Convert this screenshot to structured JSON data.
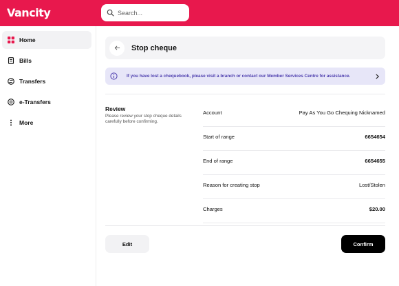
{
  "brand": {
    "logo_text": "Vancity",
    "primary_color": "#e8184d",
    "accent_purple": "#4e3fae"
  },
  "search": {
    "placeholder": "Search...",
    "icon": "search-icon"
  },
  "sidebar": {
    "items": [
      {
        "label": "Home",
        "icon": "home-grid-icon",
        "active": true
      },
      {
        "label": "Bills",
        "icon": "bill-icon",
        "active": false
      },
      {
        "label": "Transfers",
        "icon": "transfer-icon",
        "active": false
      },
      {
        "label": "e-Transfers",
        "icon": "e-transfer-icon",
        "active": false
      },
      {
        "label": "More",
        "icon": "more-vertical-icon",
        "active": false
      }
    ]
  },
  "page": {
    "title": "Stop cheque",
    "back_icon": "arrow-left-icon"
  },
  "info_banner": {
    "text": "If you have lost a chequebook, please visit a branch or contact our Member Services Centre for assistance.",
    "icon": "info-icon",
    "chevron": "chevron-right-icon"
  },
  "review": {
    "title": "Review",
    "description": "Please review your stop cheque details carefully before confirming.",
    "rows": [
      {
        "label": "Account",
        "value": "Pay As You Go Chequing Nicknamed"
      },
      {
        "label": "Start of range",
        "value": "6654654"
      },
      {
        "label": "End of range",
        "value": "6654655"
      },
      {
        "label": "Reason for creating stop",
        "value": "Lost/Stolen"
      },
      {
        "label": "Charges",
        "value": "$20.00"
      }
    ]
  },
  "actions": {
    "edit_label": "Edit",
    "confirm_label": "Confirm"
  }
}
